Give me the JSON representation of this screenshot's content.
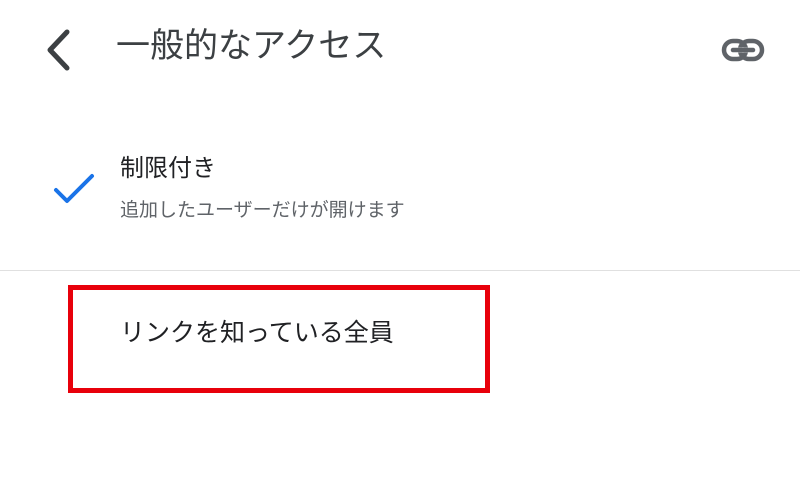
{
  "header": {
    "title": "一般的なアクセス",
    "back_icon": "chevron-left-icon",
    "link_icon": "link-icon"
  },
  "options": {
    "restricted": {
      "title": "制限付き",
      "description": "追加したユーザーだけが開けます",
      "selected": true,
      "check_icon": "check-icon",
      "check_color": "#1a73e8"
    },
    "anyone_with_link": {
      "title": "リンクを知っている全員",
      "selected": false
    }
  },
  "annotation": {
    "highlight_color": "#e8000b"
  }
}
